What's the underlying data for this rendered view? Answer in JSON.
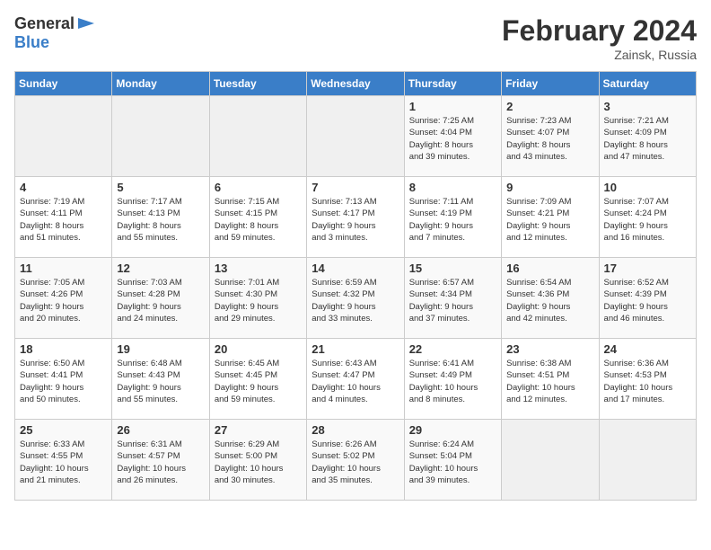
{
  "header": {
    "logo_general": "General",
    "logo_blue": "Blue",
    "month": "February 2024",
    "location": "Zainsk, Russia"
  },
  "days_of_week": [
    "Sunday",
    "Monday",
    "Tuesday",
    "Wednesday",
    "Thursday",
    "Friday",
    "Saturday"
  ],
  "weeks": [
    [
      {
        "day": "",
        "info": ""
      },
      {
        "day": "",
        "info": ""
      },
      {
        "day": "",
        "info": ""
      },
      {
        "day": "",
        "info": ""
      },
      {
        "day": "1",
        "info": "Sunrise: 7:25 AM\nSunset: 4:04 PM\nDaylight: 8 hours\nand 39 minutes."
      },
      {
        "day": "2",
        "info": "Sunrise: 7:23 AM\nSunset: 4:07 PM\nDaylight: 8 hours\nand 43 minutes."
      },
      {
        "day": "3",
        "info": "Sunrise: 7:21 AM\nSunset: 4:09 PM\nDaylight: 8 hours\nand 47 minutes."
      }
    ],
    [
      {
        "day": "4",
        "info": "Sunrise: 7:19 AM\nSunset: 4:11 PM\nDaylight: 8 hours\nand 51 minutes."
      },
      {
        "day": "5",
        "info": "Sunrise: 7:17 AM\nSunset: 4:13 PM\nDaylight: 8 hours\nand 55 minutes."
      },
      {
        "day": "6",
        "info": "Sunrise: 7:15 AM\nSunset: 4:15 PM\nDaylight: 8 hours\nand 59 minutes."
      },
      {
        "day": "7",
        "info": "Sunrise: 7:13 AM\nSunset: 4:17 PM\nDaylight: 9 hours\nand 3 minutes."
      },
      {
        "day": "8",
        "info": "Sunrise: 7:11 AM\nSunset: 4:19 PM\nDaylight: 9 hours\nand 7 minutes."
      },
      {
        "day": "9",
        "info": "Sunrise: 7:09 AM\nSunset: 4:21 PM\nDaylight: 9 hours\nand 12 minutes."
      },
      {
        "day": "10",
        "info": "Sunrise: 7:07 AM\nSunset: 4:24 PM\nDaylight: 9 hours\nand 16 minutes."
      }
    ],
    [
      {
        "day": "11",
        "info": "Sunrise: 7:05 AM\nSunset: 4:26 PM\nDaylight: 9 hours\nand 20 minutes."
      },
      {
        "day": "12",
        "info": "Sunrise: 7:03 AM\nSunset: 4:28 PM\nDaylight: 9 hours\nand 24 minutes."
      },
      {
        "day": "13",
        "info": "Sunrise: 7:01 AM\nSunset: 4:30 PM\nDaylight: 9 hours\nand 29 minutes."
      },
      {
        "day": "14",
        "info": "Sunrise: 6:59 AM\nSunset: 4:32 PM\nDaylight: 9 hours\nand 33 minutes."
      },
      {
        "day": "15",
        "info": "Sunrise: 6:57 AM\nSunset: 4:34 PM\nDaylight: 9 hours\nand 37 minutes."
      },
      {
        "day": "16",
        "info": "Sunrise: 6:54 AM\nSunset: 4:36 PM\nDaylight: 9 hours\nand 42 minutes."
      },
      {
        "day": "17",
        "info": "Sunrise: 6:52 AM\nSunset: 4:39 PM\nDaylight: 9 hours\nand 46 minutes."
      }
    ],
    [
      {
        "day": "18",
        "info": "Sunrise: 6:50 AM\nSunset: 4:41 PM\nDaylight: 9 hours\nand 50 minutes."
      },
      {
        "day": "19",
        "info": "Sunrise: 6:48 AM\nSunset: 4:43 PM\nDaylight: 9 hours\nand 55 minutes."
      },
      {
        "day": "20",
        "info": "Sunrise: 6:45 AM\nSunset: 4:45 PM\nDaylight: 9 hours\nand 59 minutes."
      },
      {
        "day": "21",
        "info": "Sunrise: 6:43 AM\nSunset: 4:47 PM\nDaylight: 10 hours\nand 4 minutes."
      },
      {
        "day": "22",
        "info": "Sunrise: 6:41 AM\nSunset: 4:49 PM\nDaylight: 10 hours\nand 8 minutes."
      },
      {
        "day": "23",
        "info": "Sunrise: 6:38 AM\nSunset: 4:51 PM\nDaylight: 10 hours\nand 12 minutes."
      },
      {
        "day": "24",
        "info": "Sunrise: 6:36 AM\nSunset: 4:53 PM\nDaylight: 10 hours\nand 17 minutes."
      }
    ],
    [
      {
        "day": "25",
        "info": "Sunrise: 6:33 AM\nSunset: 4:55 PM\nDaylight: 10 hours\nand 21 minutes."
      },
      {
        "day": "26",
        "info": "Sunrise: 6:31 AM\nSunset: 4:57 PM\nDaylight: 10 hours\nand 26 minutes."
      },
      {
        "day": "27",
        "info": "Sunrise: 6:29 AM\nSunset: 5:00 PM\nDaylight: 10 hours\nand 30 minutes."
      },
      {
        "day": "28",
        "info": "Sunrise: 6:26 AM\nSunset: 5:02 PM\nDaylight: 10 hours\nand 35 minutes."
      },
      {
        "day": "29",
        "info": "Sunrise: 6:24 AM\nSunset: 5:04 PM\nDaylight: 10 hours\nand 39 minutes."
      },
      {
        "day": "",
        "info": ""
      },
      {
        "day": "",
        "info": ""
      }
    ]
  ]
}
